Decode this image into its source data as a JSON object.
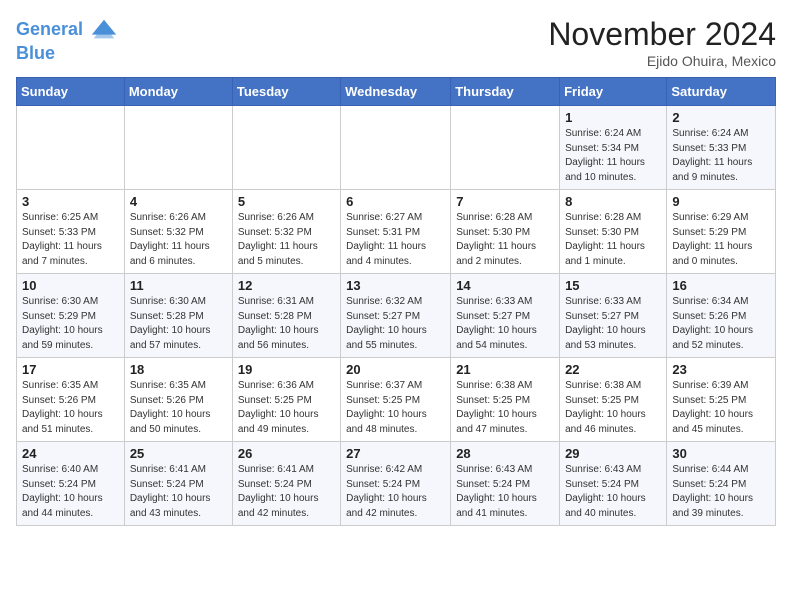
{
  "header": {
    "logo_line1": "General",
    "logo_line2": "Blue",
    "month_title": "November 2024",
    "location": "Ejido Ohuira, Mexico"
  },
  "weekdays": [
    "Sunday",
    "Monday",
    "Tuesday",
    "Wednesday",
    "Thursday",
    "Friday",
    "Saturday"
  ],
  "weeks": [
    [
      {
        "day": "",
        "info": ""
      },
      {
        "day": "",
        "info": ""
      },
      {
        "day": "",
        "info": ""
      },
      {
        "day": "",
        "info": ""
      },
      {
        "day": "",
        "info": ""
      },
      {
        "day": "1",
        "info": "Sunrise: 6:24 AM\nSunset: 5:34 PM\nDaylight: 11 hours and 10 minutes."
      },
      {
        "day": "2",
        "info": "Sunrise: 6:24 AM\nSunset: 5:33 PM\nDaylight: 11 hours and 9 minutes."
      }
    ],
    [
      {
        "day": "3",
        "info": "Sunrise: 6:25 AM\nSunset: 5:33 PM\nDaylight: 11 hours and 7 minutes."
      },
      {
        "day": "4",
        "info": "Sunrise: 6:26 AM\nSunset: 5:32 PM\nDaylight: 11 hours and 6 minutes."
      },
      {
        "day": "5",
        "info": "Sunrise: 6:26 AM\nSunset: 5:32 PM\nDaylight: 11 hours and 5 minutes."
      },
      {
        "day": "6",
        "info": "Sunrise: 6:27 AM\nSunset: 5:31 PM\nDaylight: 11 hours and 4 minutes."
      },
      {
        "day": "7",
        "info": "Sunrise: 6:28 AM\nSunset: 5:30 PM\nDaylight: 11 hours and 2 minutes."
      },
      {
        "day": "8",
        "info": "Sunrise: 6:28 AM\nSunset: 5:30 PM\nDaylight: 11 hours and 1 minute."
      },
      {
        "day": "9",
        "info": "Sunrise: 6:29 AM\nSunset: 5:29 PM\nDaylight: 11 hours and 0 minutes."
      }
    ],
    [
      {
        "day": "10",
        "info": "Sunrise: 6:30 AM\nSunset: 5:29 PM\nDaylight: 10 hours and 59 minutes."
      },
      {
        "day": "11",
        "info": "Sunrise: 6:30 AM\nSunset: 5:28 PM\nDaylight: 10 hours and 57 minutes."
      },
      {
        "day": "12",
        "info": "Sunrise: 6:31 AM\nSunset: 5:28 PM\nDaylight: 10 hours and 56 minutes."
      },
      {
        "day": "13",
        "info": "Sunrise: 6:32 AM\nSunset: 5:27 PM\nDaylight: 10 hours and 55 minutes."
      },
      {
        "day": "14",
        "info": "Sunrise: 6:33 AM\nSunset: 5:27 PM\nDaylight: 10 hours and 54 minutes."
      },
      {
        "day": "15",
        "info": "Sunrise: 6:33 AM\nSunset: 5:27 PM\nDaylight: 10 hours and 53 minutes."
      },
      {
        "day": "16",
        "info": "Sunrise: 6:34 AM\nSunset: 5:26 PM\nDaylight: 10 hours and 52 minutes."
      }
    ],
    [
      {
        "day": "17",
        "info": "Sunrise: 6:35 AM\nSunset: 5:26 PM\nDaylight: 10 hours and 51 minutes."
      },
      {
        "day": "18",
        "info": "Sunrise: 6:35 AM\nSunset: 5:26 PM\nDaylight: 10 hours and 50 minutes."
      },
      {
        "day": "19",
        "info": "Sunrise: 6:36 AM\nSunset: 5:25 PM\nDaylight: 10 hours and 49 minutes."
      },
      {
        "day": "20",
        "info": "Sunrise: 6:37 AM\nSunset: 5:25 PM\nDaylight: 10 hours and 48 minutes."
      },
      {
        "day": "21",
        "info": "Sunrise: 6:38 AM\nSunset: 5:25 PM\nDaylight: 10 hours and 47 minutes."
      },
      {
        "day": "22",
        "info": "Sunrise: 6:38 AM\nSunset: 5:25 PM\nDaylight: 10 hours and 46 minutes."
      },
      {
        "day": "23",
        "info": "Sunrise: 6:39 AM\nSunset: 5:25 PM\nDaylight: 10 hours and 45 minutes."
      }
    ],
    [
      {
        "day": "24",
        "info": "Sunrise: 6:40 AM\nSunset: 5:24 PM\nDaylight: 10 hours and 44 minutes."
      },
      {
        "day": "25",
        "info": "Sunrise: 6:41 AM\nSunset: 5:24 PM\nDaylight: 10 hours and 43 minutes."
      },
      {
        "day": "26",
        "info": "Sunrise: 6:41 AM\nSunset: 5:24 PM\nDaylight: 10 hours and 42 minutes."
      },
      {
        "day": "27",
        "info": "Sunrise: 6:42 AM\nSunset: 5:24 PM\nDaylight: 10 hours and 42 minutes."
      },
      {
        "day": "28",
        "info": "Sunrise: 6:43 AM\nSunset: 5:24 PM\nDaylight: 10 hours and 41 minutes."
      },
      {
        "day": "29",
        "info": "Sunrise: 6:43 AM\nSunset: 5:24 PM\nDaylight: 10 hours and 40 minutes."
      },
      {
        "day": "30",
        "info": "Sunrise: 6:44 AM\nSunset: 5:24 PM\nDaylight: 10 hours and 39 minutes."
      }
    ]
  ]
}
